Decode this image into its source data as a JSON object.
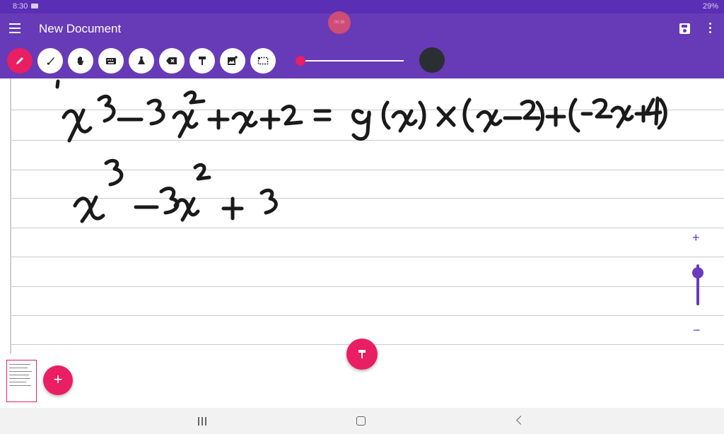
{
  "status_bar": {
    "time": "8:30",
    "battery": "29%"
  },
  "recording_indicator": "00:36",
  "app_bar": {
    "title": "New Document"
  },
  "toolbar": {
    "tools": [
      {
        "name": "pen-icon",
        "glyph": "✎",
        "active": true
      },
      {
        "name": "brush-icon",
        "glyph": "✐",
        "active": false
      },
      {
        "name": "hand-icon",
        "glyph": "✋",
        "active": false
      },
      {
        "name": "keyboard-icon",
        "glyph": "⌨",
        "active": false
      },
      {
        "name": "flask-icon",
        "glyph": "⚗",
        "active": false
      },
      {
        "name": "eraser-icon",
        "glyph": "⌫",
        "active": false
      },
      {
        "name": "format-paint-icon",
        "glyph": "🖌",
        "active": false
      },
      {
        "name": "add-image-icon",
        "glyph": "🖼",
        "active": false
      },
      {
        "name": "selection-icon",
        "glyph": "⬚",
        "active": false
      }
    ],
    "stroke_size": 0.05,
    "pen_color": "#2b2f33",
    "accent_color": "#e91e63"
  },
  "zoom": {
    "plus_label": "+",
    "minus_label": "−",
    "level": 0.9
  },
  "canvas": {
    "handwriting_lines": [
      "x³−3x²+x+2 = g(x)×(x−2)+(−2x+4)",
      "x³−3x²+3"
    ]
  },
  "page_tray": {
    "add_label": "+"
  },
  "colors": {
    "app_bar": "#673ab7",
    "status_bar": "#5a2fb5",
    "fab": "#e91e63"
  }
}
